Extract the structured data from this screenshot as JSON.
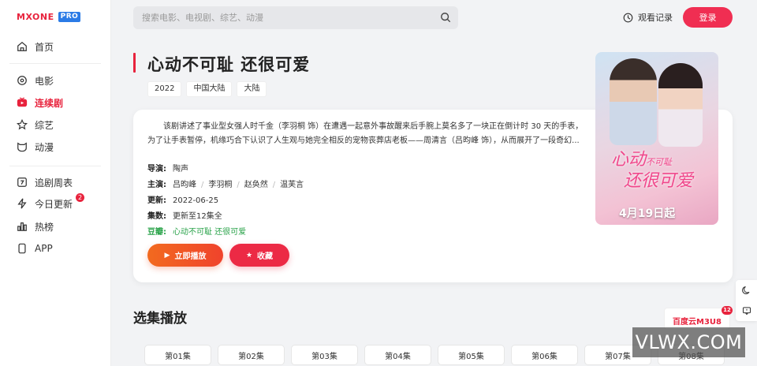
{
  "brand": {
    "logo_text": "MXONE",
    "logo_badge": "PRO",
    "accent": "#e8233d"
  },
  "sidebar": {
    "items": [
      {
        "label": "首页",
        "icon": "home-icon"
      },
      {
        "label": "电影",
        "icon": "film-icon"
      },
      {
        "label": "连续剧",
        "icon": "tv-icon",
        "active": true
      },
      {
        "label": "综艺",
        "icon": "star-icon"
      },
      {
        "label": "动漫",
        "icon": "cat-icon"
      },
      {
        "label": "追剧周表",
        "icon": "calendar-icon"
      },
      {
        "label": "今日更新",
        "icon": "bolt-icon",
        "badge": "2"
      },
      {
        "label": "热榜",
        "icon": "chart-icon"
      },
      {
        "label": "APP",
        "icon": "phone-icon"
      }
    ]
  },
  "header": {
    "search_placeholder": "搜索电影、电视剧、综艺、动漫",
    "history_label": "观看记录",
    "login_label": "登录"
  },
  "detail": {
    "title": "心动不可耻 还很可爱",
    "tags": [
      "2022",
      "中国大陆",
      "大陆"
    ],
    "description": "该剧讲述了事业型女强人时千金（李羽桐 饰）在遭遇一起意外事故醒来后手腕上莫名多了一块正在倒计时 30 天的手表，为了让手表暂停，机缘巧合下认识了人生观与她完全相反的宠物丧葬店老板——周清言（吕昀峰 饰），从而展开了一段奇幻...",
    "director_label": "导演:",
    "director": "陶声",
    "cast_label": "主演:",
    "cast": [
      "吕昀峰",
      "李羽桐",
      "赵奂然",
      "温芙言"
    ],
    "updated_label": "更新:",
    "updated": "2022-06-25",
    "episodes_label": "集数:",
    "episodes": "更新至12集全",
    "douban_label": "豆瓣:",
    "douban": "心动不可耻 还很可爱",
    "play_label": "立即播放",
    "fav_label": "收藏"
  },
  "poster": {
    "title_line1": "心动",
    "title_line2": "还很可爱",
    "small_text": "不可耻",
    "date": "4月19日起"
  },
  "episodes_section": {
    "title": "选集播放",
    "items": [
      "第01集",
      "第02集",
      "第03集",
      "第04集",
      "第05集",
      "第06集",
      "第07集",
      "第08集"
    ]
  },
  "float": {
    "m3u8_label": "百度云M3U8",
    "m3u8_badge": "12"
  },
  "watermark": "VLWX.COM"
}
